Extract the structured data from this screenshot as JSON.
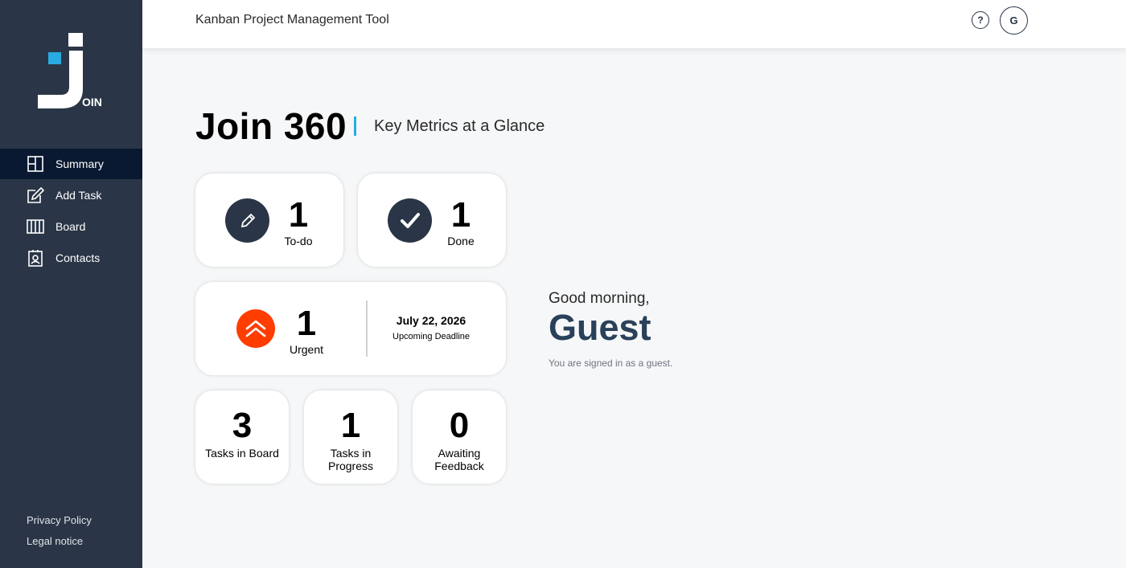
{
  "app": {
    "logo_text": "OIN",
    "header_title": "Kanban Project Management Tool"
  },
  "header": {
    "help_label": "?",
    "avatar_initial": "G"
  },
  "sidebar": {
    "items": [
      {
        "label": "Summary",
        "icon": "summary-icon",
        "active": true
      },
      {
        "label": "Add Task",
        "icon": "add-task-icon",
        "active": false
      },
      {
        "label": "Board",
        "icon": "board-icon",
        "active": false
      },
      {
        "label": "Contacts",
        "icon": "contacts-icon",
        "active": false
      }
    ],
    "legal": {
      "privacy": "Privacy Policy",
      "notice": "Legal notice"
    }
  },
  "page": {
    "title": "Join 360",
    "subtitle": "Key Metrics at a Glance"
  },
  "metrics": {
    "todo": {
      "value": "1",
      "label": "To-do",
      "icon": "pencil-icon"
    },
    "done": {
      "value": "1",
      "label": "Done",
      "icon": "check-icon"
    },
    "urgent": {
      "value": "1",
      "label": "Urgent",
      "icon": "double-chevron-up-icon",
      "deadline_date": "July 22, 2026",
      "deadline_label": "Upcoming Deadline"
    },
    "board": {
      "value": "3",
      "label": "Tasks in Board"
    },
    "progress": {
      "value": "1",
      "label": "Tasks in Progress"
    },
    "feedback": {
      "value": "0",
      "label": "Awaiting Feedback"
    }
  },
  "greeting": {
    "hello": "Good morning,",
    "name": "Guest",
    "note": "You are signed in as a guest."
  },
  "colors": {
    "sidebar": "#2a3647",
    "active": "#091931",
    "accent": "#29abe2",
    "urgent": "#ff3d00",
    "name": "#29415a"
  }
}
